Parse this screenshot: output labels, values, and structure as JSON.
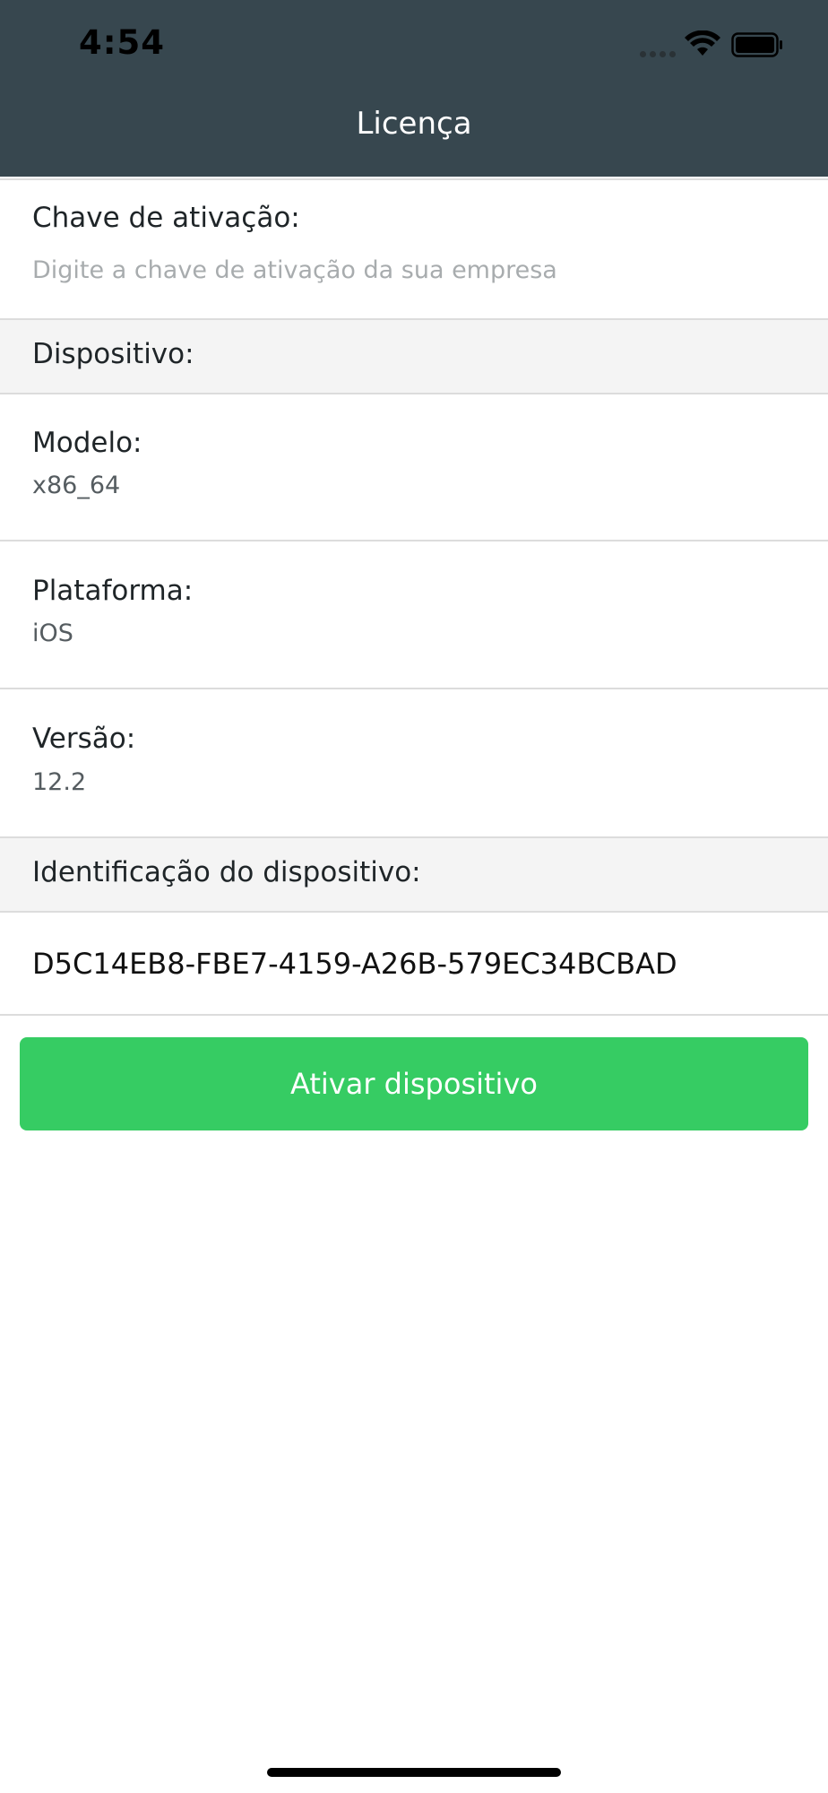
{
  "status_bar": {
    "time": "4:54",
    "wifi_icon": "wifi-icon",
    "battery_icon": "battery-icon"
  },
  "nav": {
    "title": "Licença"
  },
  "activation": {
    "label": "Chave de ativação:",
    "placeholder": "Digite a chave de ativação da sua empresa",
    "value": ""
  },
  "device_section": {
    "header": "Dispositivo:",
    "fields": [
      {
        "label": "Modelo:",
        "value": "x86_64"
      },
      {
        "label": "Plataforma:",
        "value": "iOS"
      },
      {
        "label": "Versão:",
        "value": "12.2"
      }
    ]
  },
  "identification_section": {
    "header": "Identificação do dispositivo:",
    "value": "D5C14EB8-FBE7-4159-A26B-579EC34BCBAD"
  },
  "button": {
    "label": "Ativar dispositivo"
  },
  "colors": {
    "header_bg": "#37474f",
    "button_bg": "#36cc63",
    "section_bg": "#f4f4f4"
  }
}
